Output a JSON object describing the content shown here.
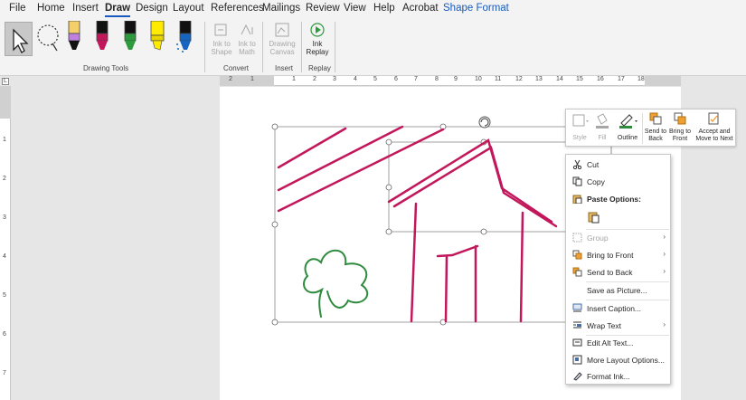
{
  "tabs": [
    "File",
    "Home",
    "Insert",
    "Draw",
    "Design",
    "Layout",
    "References",
    "Mailings",
    "Review",
    "View",
    "Help",
    "Acrobat",
    "Shape Format"
  ],
  "active_tab": "Draw",
  "ribbon": {
    "groups": {
      "drawing_tools": "Drawing Tools",
      "convert": "Convert",
      "insert": "Insert",
      "replay": "Replay"
    },
    "buttons": {
      "ink_to_shape": "Ink to Shape",
      "ink_to_math": "Ink to Math",
      "drawing_canvas": "Drawing Canvas",
      "ink_replay": "Ink Replay"
    },
    "pens": [
      {
        "name": "select-tool"
      },
      {
        "name": "lasso-select"
      },
      {
        "name": "pen-black",
        "color": "#000000",
        "band": "#c080e0"
      },
      {
        "name": "pen-magenta",
        "color": "#c2185b",
        "band": "#c2185b"
      },
      {
        "name": "pen-green",
        "color": "#2e9a3e",
        "band": "#2e9a3e"
      },
      {
        "name": "highlighter-yellow",
        "color": "#ffeb00",
        "band": "#ffeb00"
      },
      {
        "name": "pen-blue-galaxy",
        "color": "#1565c0",
        "band": "#1565c0"
      }
    ]
  },
  "ruler": {
    "h_numbers": [
      "2",
      "1",
      "1",
      "2",
      "3",
      "4",
      "5",
      "6",
      "7",
      "8",
      "9",
      "10",
      "11",
      "12",
      "13",
      "14",
      "15",
      "16",
      "17",
      "18"
    ],
    "v_numbers": [
      "1",
      "2",
      "3",
      "4",
      "5",
      "6",
      "7"
    ],
    "corner": "L"
  },
  "minibar": {
    "style": "Style",
    "fill": "Fill",
    "outline": "Outline",
    "send_to_back": "Send to Back",
    "bring_to_front": "Bring to Front",
    "accept_and_move": "Accept and Move to Next"
  },
  "context_menu": {
    "cut": "Cut",
    "copy": "Copy",
    "paste_options": "Paste Options:",
    "group": "Group",
    "bring_to_front": "Bring to Front",
    "send_to_back": "Send to Back",
    "save_as_picture": "Save as Picture...",
    "insert_caption": "Insert Caption...",
    "wrap_text": "Wrap Text",
    "edit_alt_text": "Edit Alt Text...",
    "more_layout_options": "More Layout Options...",
    "format_ink": "Format Ink..."
  },
  "colors": {
    "ink_magenta": "#c2185b",
    "ink_green": "#2e8b3e",
    "accent": "#185abd"
  }
}
